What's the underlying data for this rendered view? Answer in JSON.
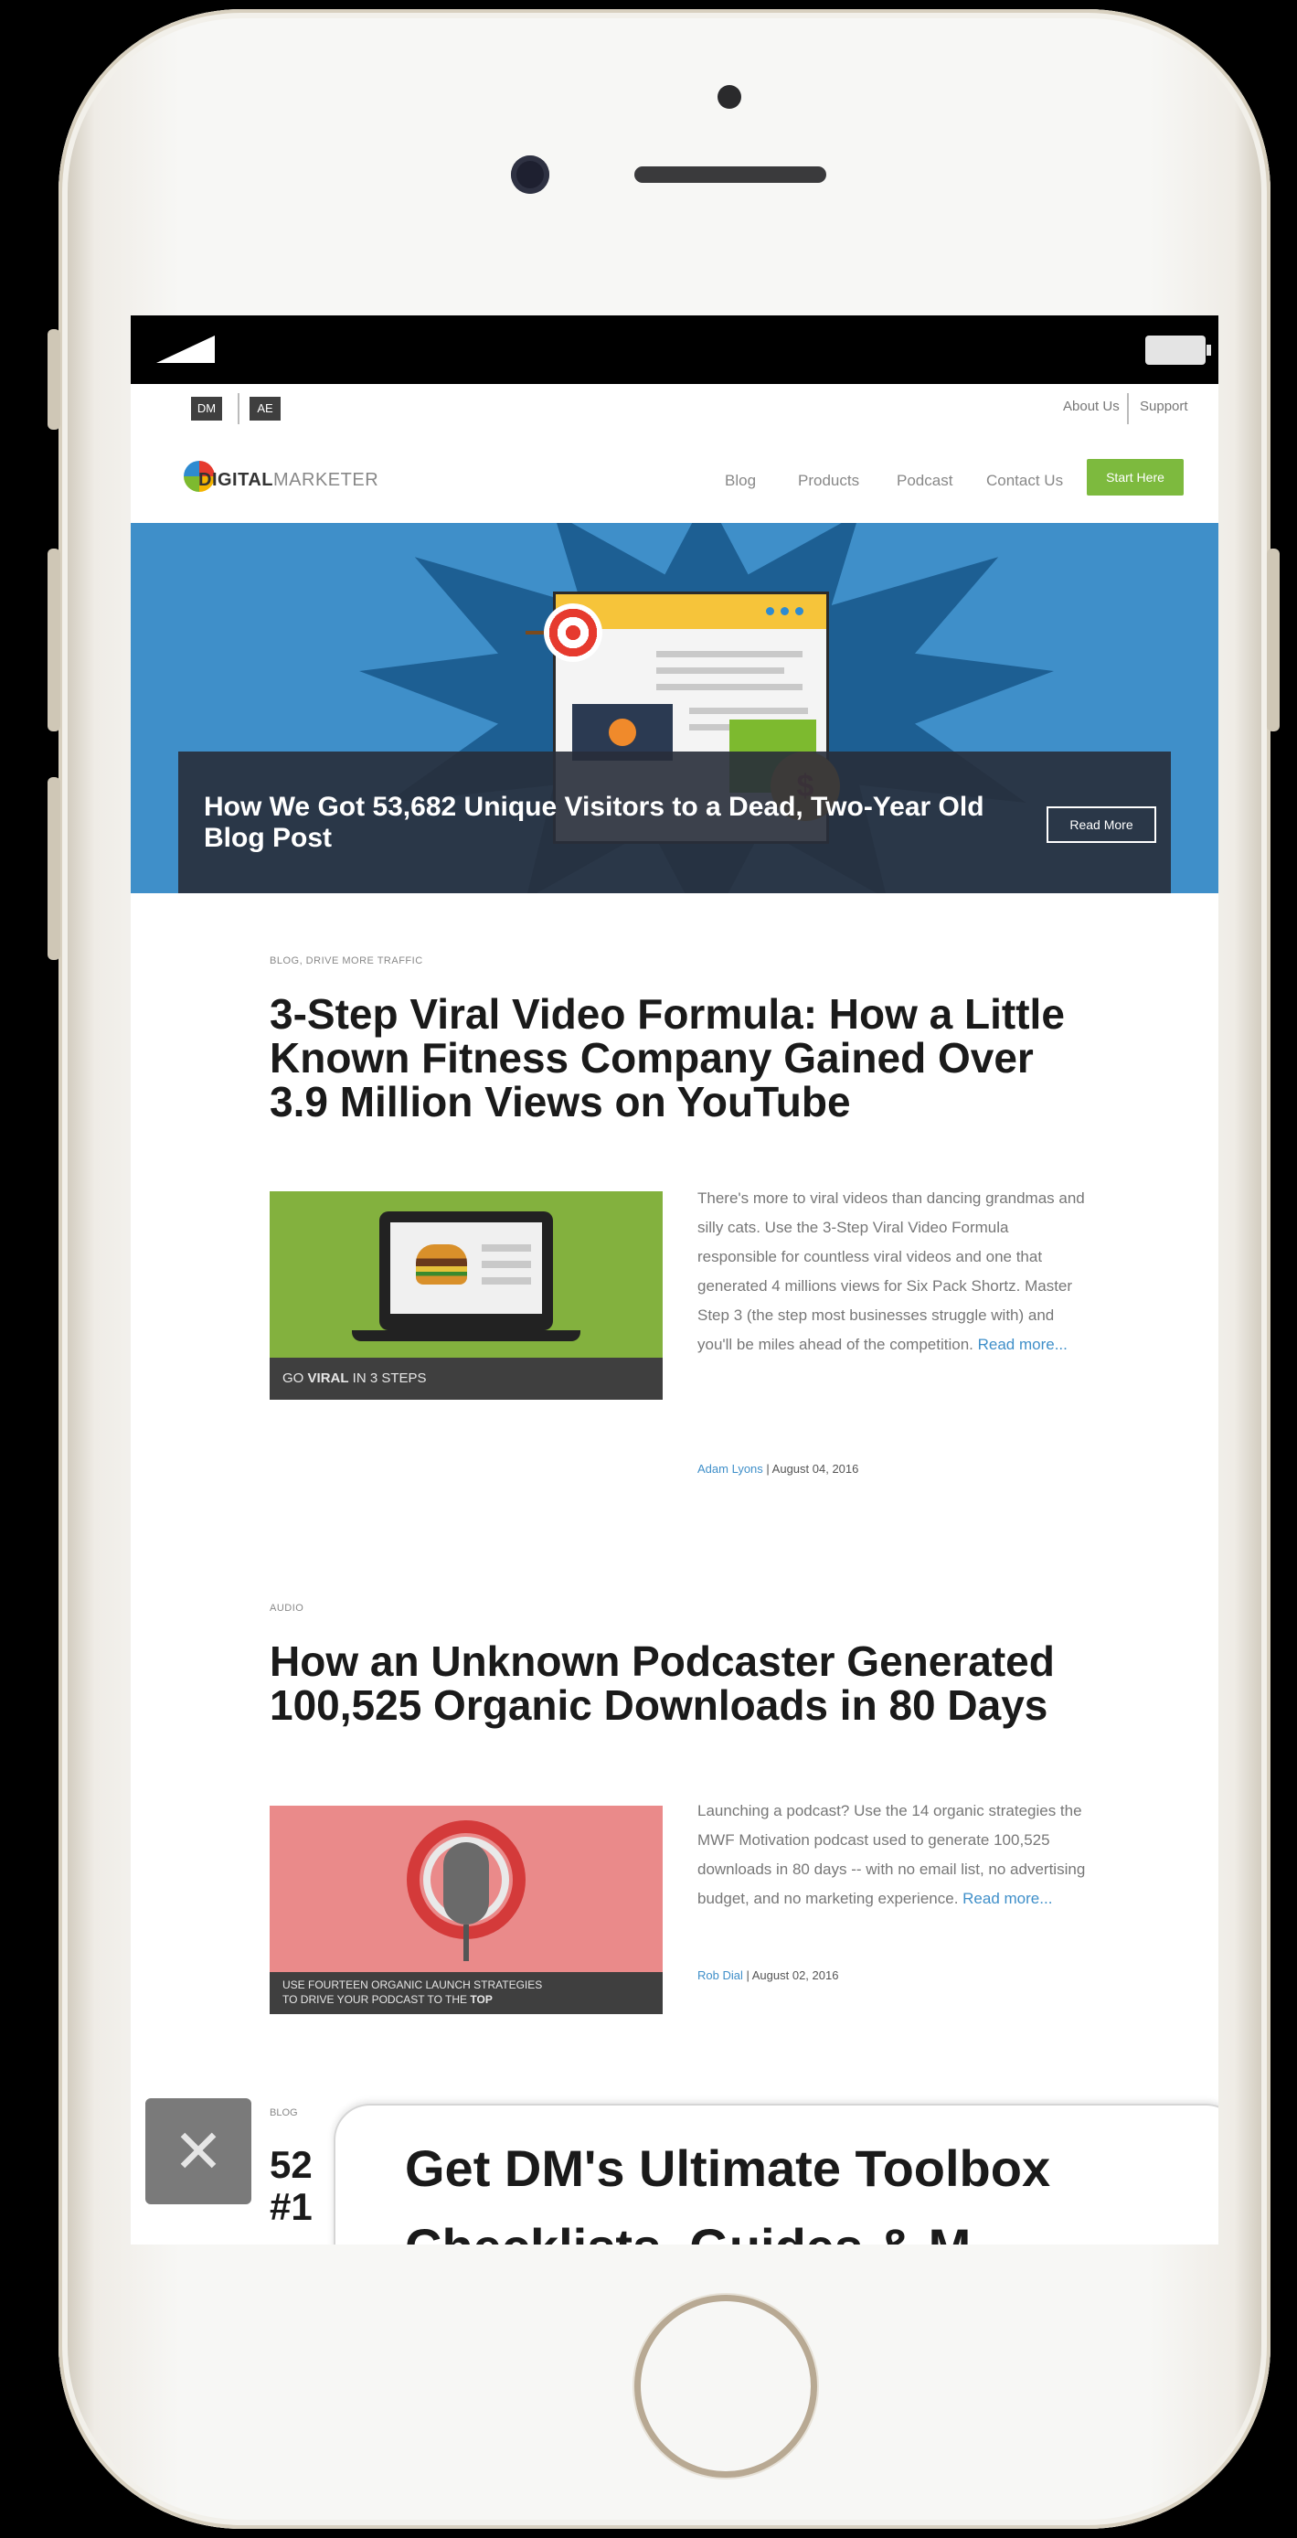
{
  "device": {
    "frame_color": "#f7f7f5",
    "accent": "#3f8fc9"
  },
  "util_bar": {
    "logos": [
      "DM",
      "AE"
    ],
    "links": [
      "About Us",
      "Support"
    ]
  },
  "nav": {
    "brand_bold": "DIGITAL",
    "brand_light": "MARKETER",
    "links": [
      "Blog",
      "Products",
      "Podcast",
      "Contact Us"
    ],
    "cta": "Start Here",
    "cta_color": "#7dba3e"
  },
  "hero": {
    "title": "How We Got 53,682 Unique Visitors to a Dead, Two-Year Old Blog Post",
    "button": "Read More",
    "background": "#3f8fc9"
  },
  "posts": [
    {
      "category": "BLOG, DRIVE MORE TRAFFIC",
      "title": "3-Step Viral Video Formula: How a Little Known Fitness Company Gained Over 3.9 Million Views on YouTube",
      "thumb_caption_pre": "GO ",
      "thumb_caption_bold": "VIRAL",
      "thumb_caption_post": " IN 3 STEPS",
      "excerpt": "There's more to viral videos than dancing grandmas and silly cats. Use the 3-Step Viral Video Formula responsible for countless viral videos and one that generated 4 millions views for Six Pack Shortz. Master Step 3 (the step most businesses struggle with) and you'll be miles ahead of the competition.",
      "read_more": "Read more...",
      "author": "Adam Lyons",
      "date": "August 04, 2016"
    },
    {
      "category": "AUDIO",
      "title": "How an Unknown Podcaster Generated 100,525 Organic Downloads in 80 Days",
      "thumb_caption_line1": "USE FOURTEEN ORGANIC LAUNCH STRATEGIES",
      "thumb_caption_line2_pre": "TO DRIVE YOUR PODCAST TO THE ",
      "thumb_caption_line2_bold": "TOP",
      "excerpt": "Launching a podcast? Use the 14 organic strategies the MWF Motivation podcast used to generate 100,525 downloads in 80 days -- with no email list, no advertising budget, and no marketing experience.",
      "read_more": "Read more...",
      "author": "Rob Dial",
      "date": "August 02, 2016"
    }
  ],
  "partial_post": {
    "category": "BLOG",
    "title_partial": "52 #1"
  },
  "popup": {
    "close_label": "✕",
    "title": "Get DM's Ultimate Toolbox",
    "subtitle_partial": "Checklists, Guides & M"
  }
}
